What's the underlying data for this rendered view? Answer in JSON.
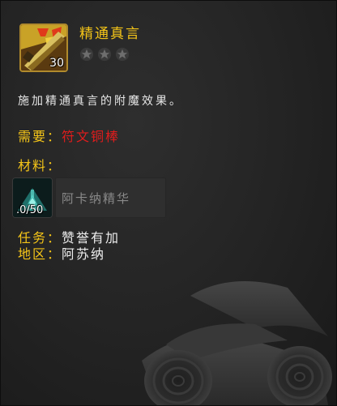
{
  "recipe": {
    "name": "精通真言",
    "icon": "enchanting-rod-icon",
    "icon_count": "30",
    "rank_stars": 3,
    "rank_filled": 0,
    "description": "施加精通真言的附魔效果。"
  },
  "requirement": {
    "label": "需要：",
    "value": "符文铜棒"
  },
  "materials": {
    "label": "材料：",
    "items": [
      {
        "name": "阿卡纳精华",
        "count": ".0/50",
        "icon": "arcane-essence-icon"
      }
    ]
  },
  "quest": {
    "label": "任务：",
    "value": "赞誉有加"
  },
  "zone": {
    "label": "地区：",
    "value": "阿苏纳"
  },
  "colors": {
    "gold": "#f5c518",
    "red": "#e01c1c",
    "text": "#e6e6e6",
    "muted": "#8a8a8a"
  }
}
